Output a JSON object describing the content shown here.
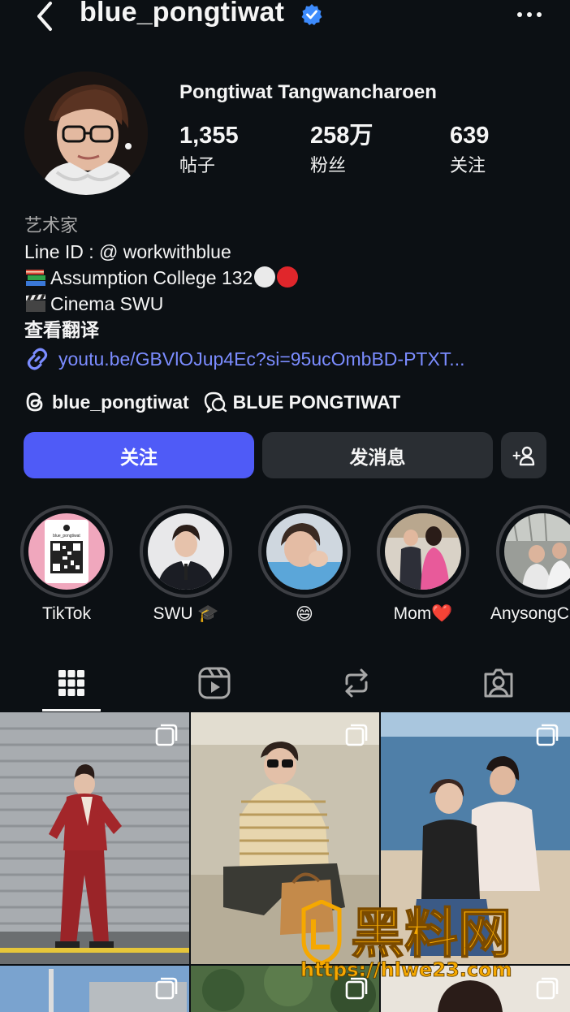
{
  "header": {
    "username": "blue_pongtiwat"
  },
  "profile": {
    "full_name": "Pongtiwat Tangwancharoen",
    "stats": [
      {
        "value": "1,355",
        "label": "帖子"
      },
      {
        "value": "258万",
        "label": "粉丝"
      },
      {
        "value": "639",
        "label": "关注"
      }
    ],
    "category": "艺术家",
    "bio_line_id": "Line ID : @ workwithblue",
    "bio_school": "Assumption College 132",
    "bio_cinema": "Cinema SWU",
    "see_translation": "查看翻译",
    "link": "youtu.be/GBVlOJup4Ec?si=95ucOmbBD-PTXT...",
    "threads_handle": "blue_pongtiwat",
    "channel_name": "BLUE PONGTIWAT"
  },
  "actions": {
    "follow": "关注",
    "message": "发消息"
  },
  "highlights": [
    {
      "label": "TikTok",
      "qr_caption": "blue_pongtiwat"
    },
    {
      "label": "SWU 🎓"
    },
    {
      "label": "😄"
    },
    {
      "label": "Mom❤️"
    },
    {
      "label": "AnysongC"
    }
  ],
  "tabs": [
    "posts-grid",
    "reels",
    "reposts",
    "tagged"
  ],
  "watermark": {
    "brand": "黑料网",
    "url": "https://hlwe23.com"
  },
  "colors": {
    "accent": "#4f5bf7",
    "link": "#7b8cff",
    "verified": "#3d8bfd",
    "background": "#0c1014"
  }
}
